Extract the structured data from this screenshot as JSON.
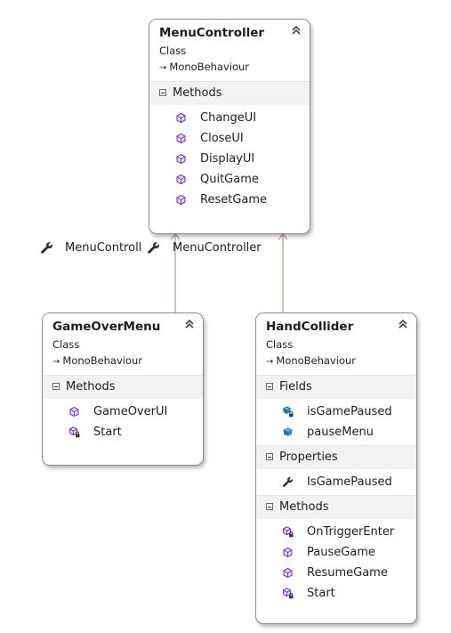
{
  "menu_controller": {
    "title": "MenuController",
    "kind": "Class",
    "base": "MonoBehaviour",
    "sections": [
      {
        "label": "Methods",
        "items": [
          "ChangeUI",
          "CloseUI",
          "DisplayUI",
          "QuitGame",
          "ResetGame"
        ]
      }
    ]
  },
  "game_over_menu": {
    "title": "GameOverMenu",
    "kind": "Class",
    "base": "MonoBehaviour",
    "sections": [
      {
        "label": "Methods",
        "items": [
          "GameOverUI",
          "Start"
        ]
      }
    ]
  },
  "hand_collider": {
    "title": "HandCollider",
    "kind": "Class",
    "base": "MonoBehaviour",
    "sections": [
      {
        "label": "Fields",
        "items": [
          "isGamePaused",
          "pauseMenu"
        ]
      },
      {
        "label": "Properties",
        "items": [
          "IsGamePaused"
        ]
      },
      {
        "label": "Methods",
        "items": [
          "OnTriggerEnter",
          "PauseGame",
          "ResumeGame",
          "Start"
        ]
      }
    ]
  },
  "associations": {
    "left_label": "MenuControll",
    "right_label": "MenuController"
  },
  "colors": {
    "connector": "#c39b86",
    "method_icon": "#7a3fb0",
    "field_icon": "#1f6fb8",
    "section_bg": "#f1f2f4"
  },
  "icons": {
    "collapse": "double-chevron-up-icon",
    "inherits": "inheritance-arrow-icon",
    "method": "method-cube-icon",
    "private_method": "private-method-cube-lock-icon",
    "field": "field-icon",
    "private_field": "private-field-lock-icon",
    "property": "wrench-icon"
  }
}
